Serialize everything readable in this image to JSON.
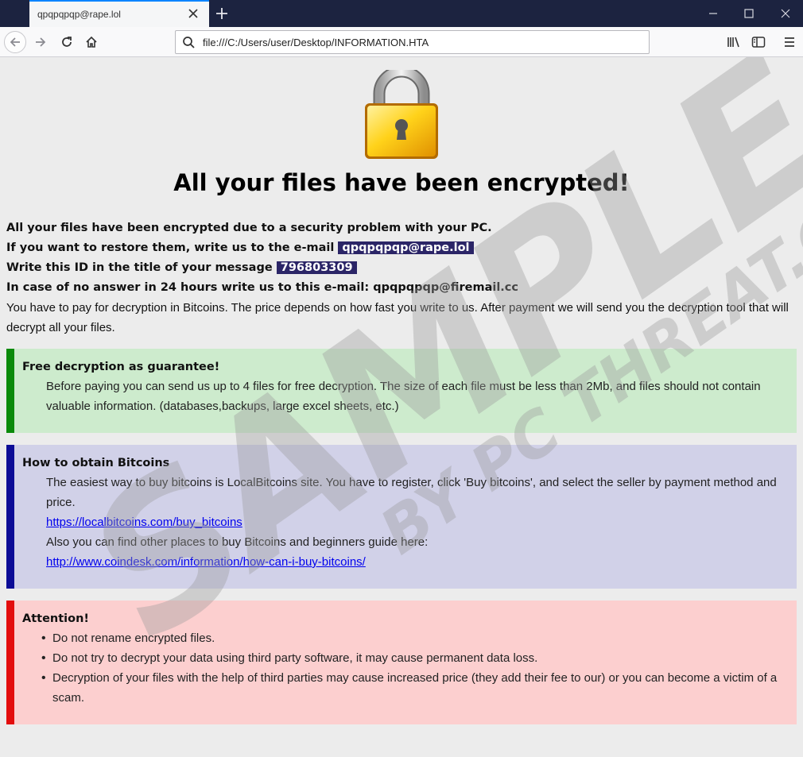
{
  "browser": {
    "tab_title": "qpqpqpqp@rape.lol",
    "url": "file:///C:/Users/user/Desktop/INFORMATION.HTA"
  },
  "page": {
    "headline": "All your files have been encrypted!",
    "line1": "All your files have been encrypted due to a security problem with your PC.",
    "line2_prefix": "If you want to restore them, write us to the e-mail",
    "email": "qpqpqpqp@rape.lol",
    "line3_prefix": "Write this ID in the title of your message",
    "id": "796803309",
    "line4": "In case of no answer in 24 hours write us to this e-mail: qpqpqpqp@firemail.cc",
    "line5": "You have to pay for decryption in Bitcoins. The price depends on how fast you write to us. After payment we will send you the decryption tool that will decrypt all your files."
  },
  "guarantee": {
    "title": "Free decryption as guarantee!",
    "text": "Before paying you can send us up to 4 files for free decryption. The size of each file must be less than 2Mb, and files should not contain valuable information. (databases,backups, large excel sheets, etc.)"
  },
  "bitcoins": {
    "title": "How to obtain Bitcoins",
    "text1": "The easiest way to buy bitcoins is LocalBitcoins site. You have to register, click 'Buy bitcoins', and select the seller by payment method and price.",
    "link1": "https://localbitcoins.com/buy_bitcoins",
    "text2": "Also you can find other places to buy Bitcoins and beginners guide here:",
    "link2": "http://www.coindesk.com/information/how-can-i-buy-bitcoins/"
  },
  "attention": {
    "title": "Attention!",
    "items": [
      "Do not rename encrypted files.",
      "Do not try to decrypt your data using third party software, it may cause permanent data loss.",
      "Decryption of your files with the help of third parties may cause increased price (they add their fee to our) or you can become a victim of a scam."
    ]
  },
  "watermark": {
    "line1": "SAMPLE",
    "line2": "BY PC THREAT.COM"
  },
  "colors": {
    "green_border": "#0b8a0b",
    "blue_border": "#0c0c96",
    "red_border": "#e30d0d",
    "highlight": "#2b2567"
  }
}
